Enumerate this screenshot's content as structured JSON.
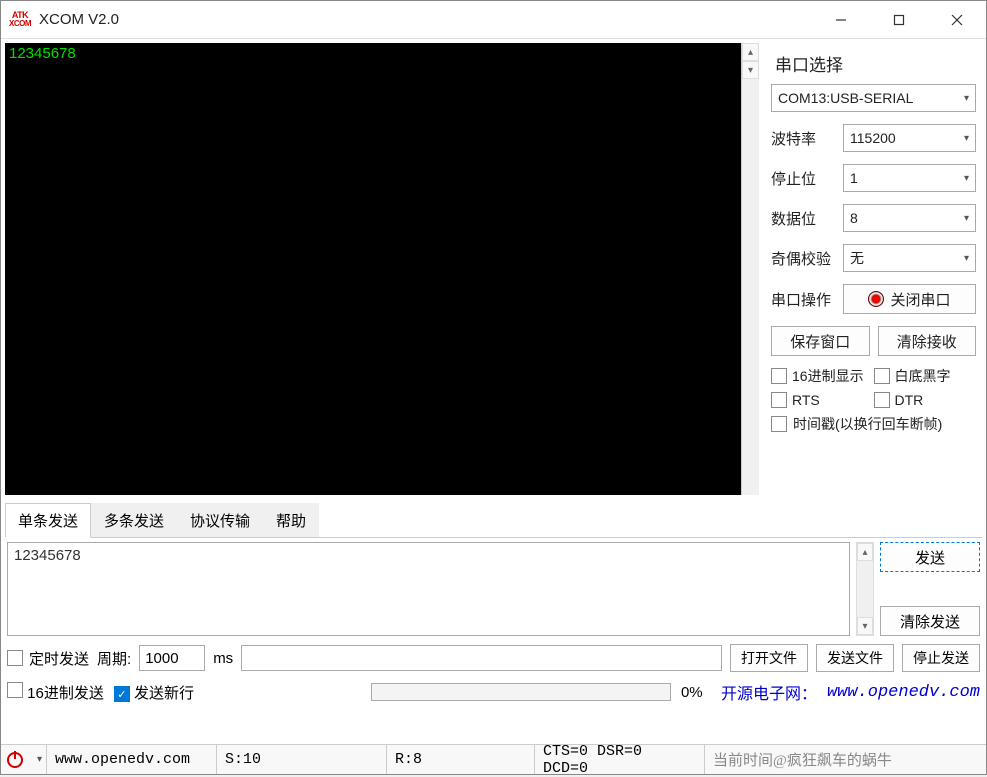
{
  "window": {
    "title": "XCOM V2.0",
    "icon_line1": "ATK",
    "icon_line2": "XCOM"
  },
  "terminal": {
    "output": "12345678"
  },
  "side": {
    "heading": "串口选择",
    "port_value": "COM13:USB-SERIAL",
    "baud_label": "波特率",
    "baud_value": "115200",
    "stop_label": "停止位",
    "stop_value": "1",
    "data_label": "数据位",
    "data_value": "8",
    "parity_label": "奇偶校验",
    "parity_value": "无",
    "op_label": "串口操作",
    "op_button": "关闭串口",
    "save_btn": "保存窗口",
    "clear_rx_btn": "清除接收",
    "chk_hexdisp": "16进制显示",
    "chk_whitebg": "白底黑字",
    "chk_rts": "RTS",
    "chk_dtr": "DTR",
    "chk_timestamp": "时间戳(以换行回车断帧)"
  },
  "tabs": {
    "t1": "单条发送",
    "t2": "多条发送",
    "t3": "协议传输",
    "t4": "帮助"
  },
  "send": {
    "text": "12345678",
    "send_btn": "发送",
    "clear_btn": "清除发送"
  },
  "options": {
    "timed_send": "定时发送",
    "period_label": "周期:",
    "period_value": "1000",
    "period_unit": "ms",
    "open_file": "打开文件",
    "send_file": "发送文件",
    "stop_send": "停止发送",
    "hex_send": "16进制发送",
    "send_newline": "发送新行",
    "percent": "0%",
    "link_label": "开源电子网：",
    "link_url": "www.openedv.com"
  },
  "status": {
    "url": "www.openedv.com",
    "s": "S:10",
    "r": "R:8",
    "cts": "CTS=0 DSR=0 DCD=0",
    "watermark": "当前时间@疯狂飙车的蜗牛"
  }
}
